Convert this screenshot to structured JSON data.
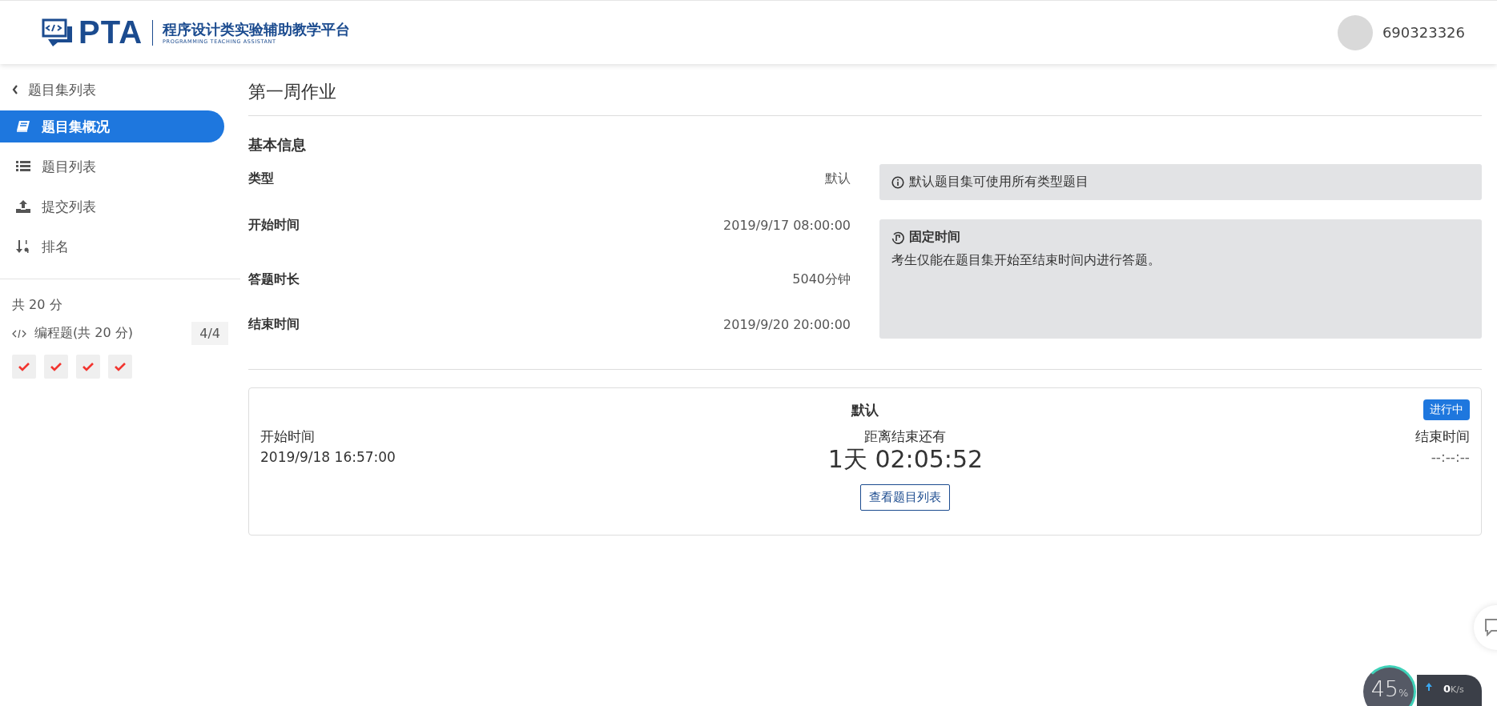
{
  "header": {
    "logo_text": "PTA",
    "logo_title": "程序设计类实验辅助教学平台",
    "logo_subtitle": "PROGRAMMING TEACHING ASSISTANT",
    "username": "690323326"
  },
  "sidebar": {
    "back": "题目集列表",
    "items": [
      {
        "label": "题目集概况",
        "kind": "book",
        "selected": true
      },
      {
        "label": "题目列表",
        "kind": "list",
        "selected": false
      },
      {
        "label": "提交列表",
        "kind": "upload",
        "selected": false
      },
      {
        "label": "排名",
        "kind": "sort",
        "selected": false
      }
    ],
    "total": "共 20 分",
    "group": {
      "label": "编程题(共 20 分)",
      "count": "4/4",
      "problems": [
        {
          "solved": true
        },
        {
          "solved": true
        },
        {
          "solved": true
        },
        {
          "solved": true
        }
      ]
    }
  },
  "page": {
    "title": "第一周作业",
    "section": "基本信息",
    "fields": [
      {
        "label": "类型",
        "value": "默认"
      },
      {
        "label": "开始时间",
        "value": "2019/9/17 08:00:00"
      },
      {
        "label": "答题时长",
        "value": "5040分钟"
      },
      {
        "label": "结束时间",
        "value": "2019/9/20 20:00:00"
      }
    ],
    "info_note": "默认题目集可使用所有类型题目",
    "mode_title": "固定时间",
    "mode_text": "考生仅能在题目集开始至结束时间内进行答题。"
  },
  "card": {
    "title": "默认",
    "status": "进行中",
    "start_label": "开始时间",
    "start_value": "2019/9/18 16:57:00",
    "remain_label": "距离结束还有",
    "remain_value": "1天 02:05:52",
    "end_label": "结束时间",
    "end_value": "--:--:--",
    "button": "查看题目列表"
  },
  "widget": {
    "percent": "45",
    "percent_unit": "%",
    "speed": "0",
    "speed_unit": "K/s"
  }
}
